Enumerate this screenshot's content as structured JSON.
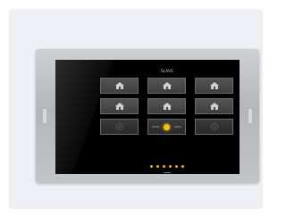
{
  "panel": {
    "title": "SLAVE",
    "center": {
      "left_label": "AUTO",
      "right_label": "100%"
    },
    "tiles": [
      {
        "icon": "house-icon",
        "dim": false
      },
      {
        "icon": "house-icon",
        "dim": false
      },
      {
        "icon": "house-icon",
        "dim": false
      },
      {
        "icon": "house-icon",
        "dim": false
      },
      {
        "icon": "house-icon",
        "dim": false
      },
      {
        "icon": "house-icon",
        "dim": false
      },
      {
        "icon": "plus-circle-icon",
        "dim": true
      },
      {
        "icon": "sun-icon",
        "dim": false
      },
      {
        "icon": "plus-circle-icon",
        "dim": true
      }
    ],
    "page_dots": 6
  },
  "colors": {
    "accent_yellow": "#f5c400",
    "frame": "#b5b6ba",
    "screen": "#000000"
  }
}
